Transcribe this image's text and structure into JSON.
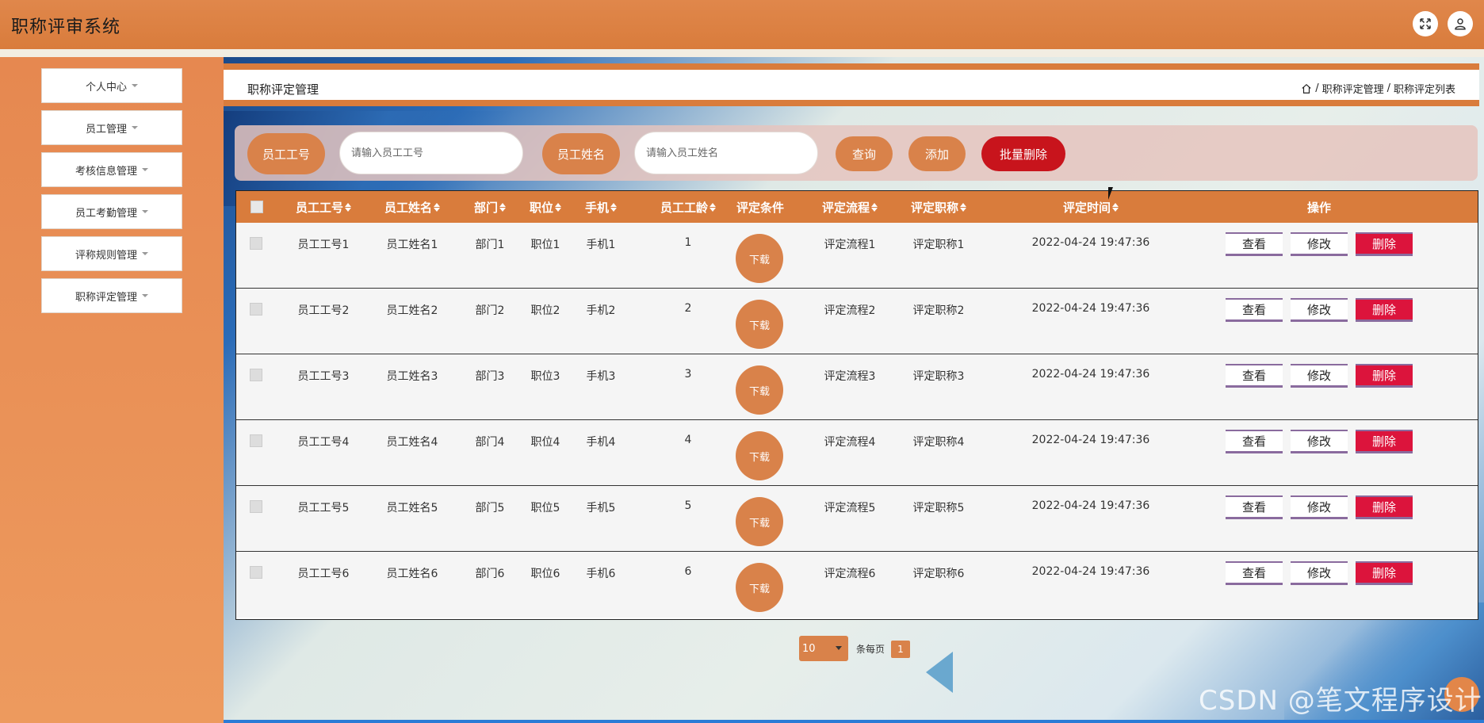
{
  "app": {
    "title": "职称评审系统"
  },
  "sidebar": {
    "items": [
      {
        "label": "个人中心"
      },
      {
        "label": "员工管理"
      },
      {
        "label": "考核信息管理"
      },
      {
        "label": "员工考勤管理"
      },
      {
        "label": "评称规则管理"
      },
      {
        "label": "职称评定管理"
      }
    ]
  },
  "page": {
    "title": "职称评定管理",
    "breadcrumb": [
      "职称评定管理",
      "职称评定列表"
    ],
    "separator": "/"
  },
  "search": {
    "emp_id_label": "员工工号",
    "emp_id_placeholder": "请输入员工工号",
    "emp_name_label": "员工姓名",
    "emp_name_placeholder": "请输入员工姓名",
    "query_label": "查询",
    "add_label": "添加",
    "batch_delete_label": "批量删除"
  },
  "table": {
    "columns": [
      "员工工号",
      "员工姓名",
      "部门",
      "职位",
      "手机",
      "员工工龄",
      "评定条件",
      "评定流程",
      "评定职称",
      "评定时间",
      "操作"
    ],
    "download_label": "下载",
    "view_label": "查看",
    "edit_label": "修改",
    "delete_label": "删除",
    "rows": [
      {
        "emp_id": "员工工号1",
        "emp_name": "员工姓名1",
        "dept": "部门1",
        "position": "职位1",
        "phone": "手机1",
        "years": "1",
        "process": "评定流程1",
        "title": "评定职称1",
        "time": "2022-04-24 19:47:36"
      },
      {
        "emp_id": "员工工号2",
        "emp_name": "员工姓名2",
        "dept": "部门2",
        "position": "职位2",
        "phone": "手机2",
        "years": "2",
        "process": "评定流程2",
        "title": "评定职称2",
        "time": "2022-04-24 19:47:36"
      },
      {
        "emp_id": "员工工号3",
        "emp_name": "员工姓名3",
        "dept": "部门3",
        "position": "职位3",
        "phone": "手机3",
        "years": "3",
        "process": "评定流程3",
        "title": "评定职称3",
        "time": "2022-04-24 19:47:36"
      },
      {
        "emp_id": "员工工号4",
        "emp_name": "员工姓名4",
        "dept": "部门4",
        "position": "职位4",
        "phone": "手机4",
        "years": "4",
        "process": "评定流程4",
        "title": "评定职称4",
        "time": "2022-04-24 19:47:36"
      },
      {
        "emp_id": "员工工号5",
        "emp_name": "员工姓名5",
        "dept": "部门5",
        "position": "职位5",
        "phone": "手机5",
        "years": "5",
        "process": "评定流程5",
        "title": "评定职称5",
        "time": "2022-04-24 19:47:36"
      },
      {
        "emp_id": "员工工号6",
        "emp_name": "员工姓名6",
        "dept": "部门6",
        "position": "职位6",
        "phone": "手机6",
        "years": "6",
        "process": "评定流程6",
        "title": "评定职称6",
        "time": "2022-04-24 19:47:36"
      }
    ]
  },
  "pagination": {
    "page_size": "10",
    "per_page_label": "条每页",
    "current_page": "1"
  },
  "watermark": "CSDN @笔文程序设计",
  "colors": {
    "accent": "#d97c3c",
    "danger": "#dc143c"
  },
  "icons": {
    "fullscreen": "fullscreen-icon",
    "user": "user-icon",
    "home": "home-icon"
  }
}
